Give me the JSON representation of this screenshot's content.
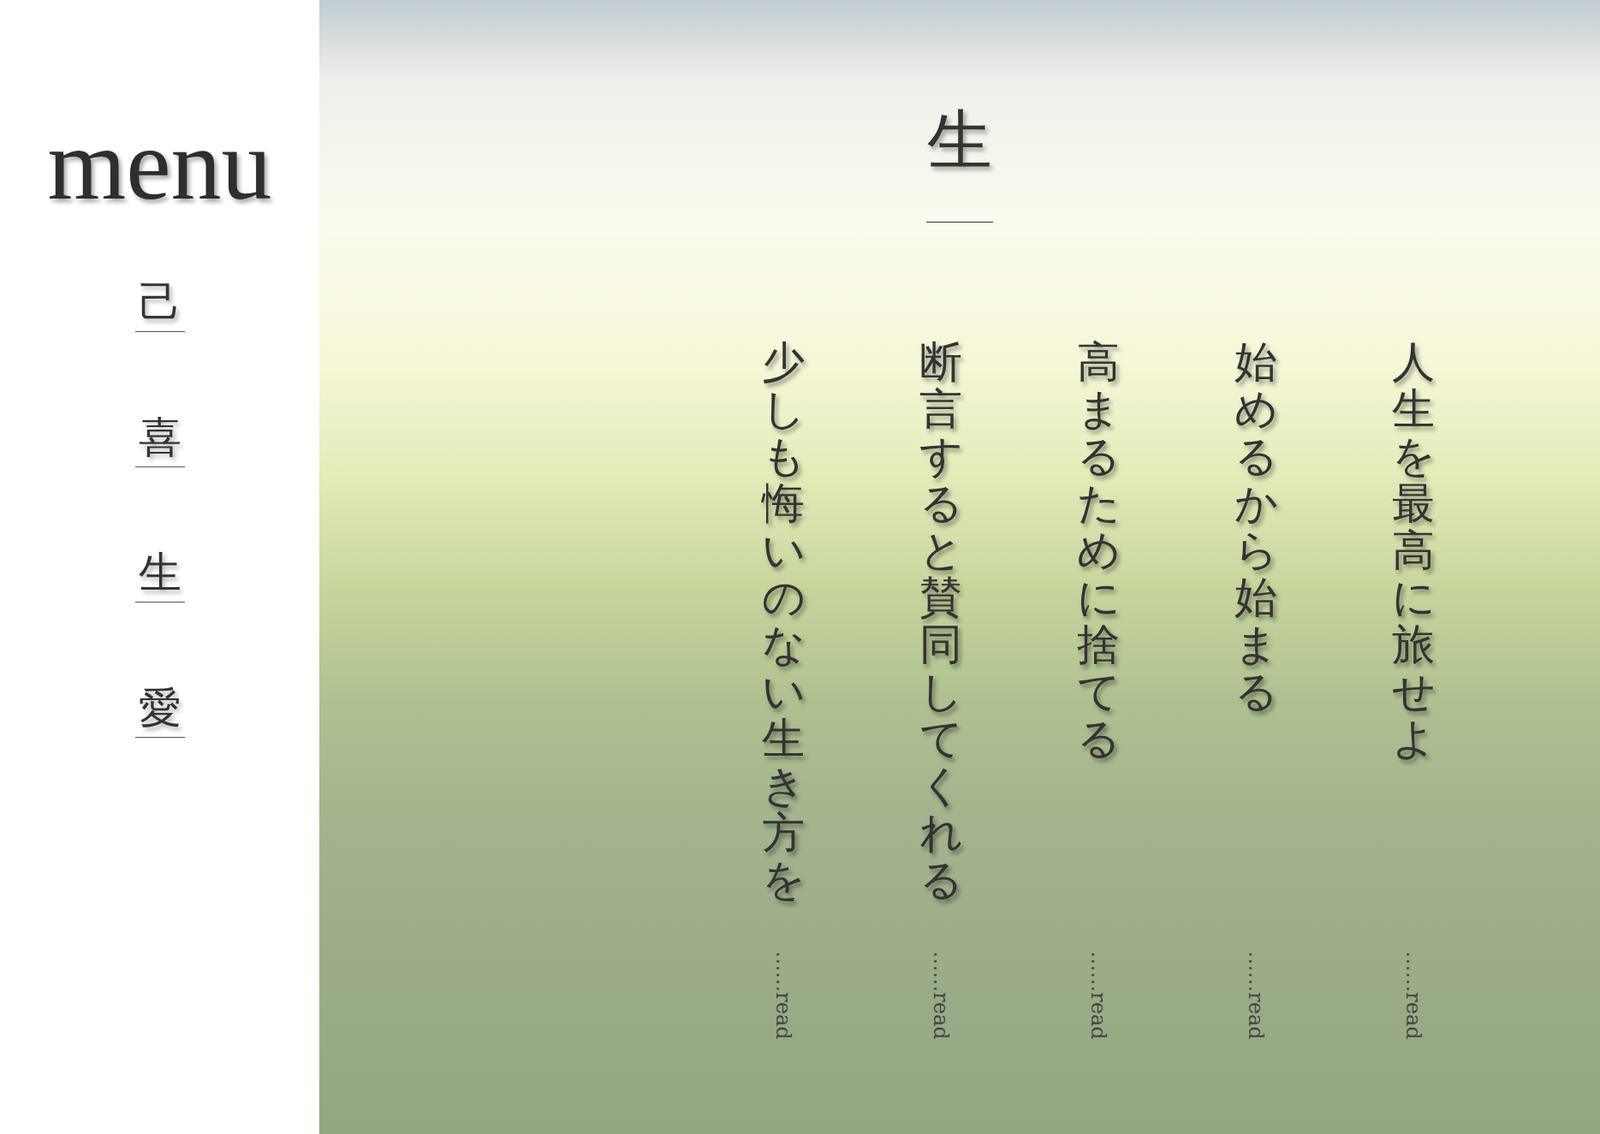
{
  "sidebar": {
    "title": "menu",
    "items": [
      {
        "label": "己"
      },
      {
        "label": "喜"
      },
      {
        "label": "生"
      },
      {
        "label": "愛"
      }
    ]
  },
  "page": {
    "title": "生"
  },
  "articles": [
    {
      "title": "人生を最高に旅せよ",
      "link": "……read"
    },
    {
      "title": "始めるから始まる",
      "link": "……read"
    },
    {
      "title": "高まるために捨てる",
      "link": "……read"
    },
    {
      "title": "断言すると賛同してくれる",
      "link": "……read"
    },
    {
      "title": "少しも悔いのない生き方を",
      "link": "……read"
    }
  ]
}
